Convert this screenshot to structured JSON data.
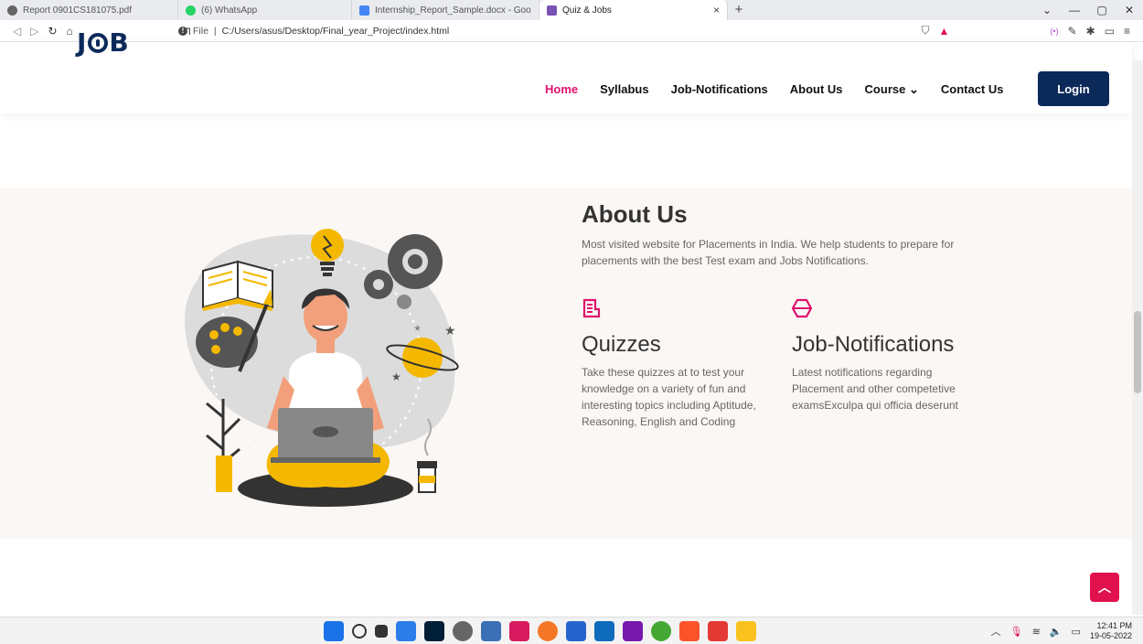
{
  "browser": {
    "tabs": [
      {
        "title": "Report 0901CS181075.pdf",
        "color": "#666666"
      },
      {
        "title": "(6) WhatsApp",
        "color": "#25d366"
      },
      {
        "title": "Internship_Report_Sample.docx - Goo",
        "color": "#4285f4"
      },
      {
        "title": "Quiz & Jobs",
        "color": "#7952b3"
      }
    ],
    "url_prefix": "File",
    "url": "C:/Users/asus/Desktop/Final_year_Project/index.html"
  },
  "site": {
    "logo": [
      "J",
      "B"
    ],
    "nav": [
      "Home",
      "Syllabus",
      "Job-Notifications",
      "About Us",
      "Course",
      "Contact Us"
    ],
    "active_nav": "Home",
    "login": "Login",
    "accent": "#e0116d",
    "brand": "#0b2a5a"
  },
  "about": {
    "title": "About Us",
    "description": "Most visited website for Placements in India. We help students to prepare for placements with the best Test exam and Jobs Notifications.",
    "features": [
      {
        "icon": "quiz-icon",
        "title": "Quizzes",
        "text": "Take these quizzes at to test your knowledge on a variety of fun and interesting topics including Aptitude, Reasoning, English and Coding"
      },
      {
        "icon": "cube-icon",
        "title": "Job-Notifications",
        "text": "Latest notifications regarding Placement and other competetive examsExculpa qui officia deserunt"
      }
    ]
  },
  "taskbar": {
    "time": "12:41 PM",
    "date": "19-05-2022"
  }
}
